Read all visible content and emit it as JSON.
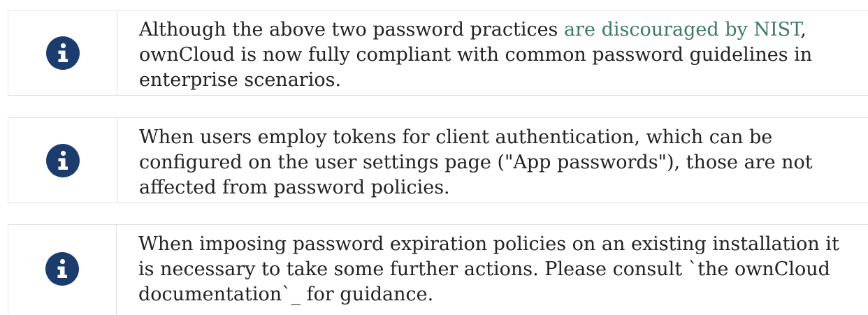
{
  "notes": [
    {
      "icon": "info-circle-icon",
      "text_before": "Although the above two password practices ",
      "link": "are discouraged by NIST",
      "text_after": ", ownCloud is now fully compliant with common password guidelines in enterprise scenarios."
    },
    {
      "icon": "info-circle-icon",
      "text": "When users employ tokens for client authentication, which can be configured on the user settings page (\"App passwords\"), those are not affected from password policies."
    },
    {
      "icon": "info-circle-icon",
      "text": "When imposing password expiration policies on an existing installation it is necessary to take some further actions. Please consult `the ownCloud documentation`_ for guidance."
    }
  ],
  "colors": {
    "icon_background": "#1d3c6e",
    "link": "#3e7a63",
    "text": "#222222",
    "border": "#e0e0e0"
  }
}
